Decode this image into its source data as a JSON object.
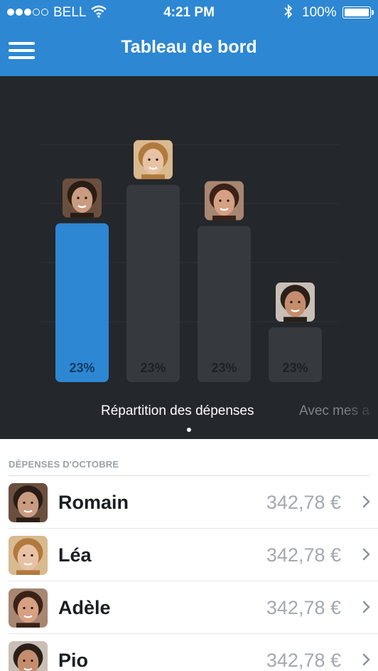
{
  "status_bar": {
    "carrier": "BELL",
    "time": "4:21 PM",
    "battery": "100%",
    "signal_dots_filled": 3,
    "signal_dots_total": 5
  },
  "nav": {
    "title": "Tableau de bord",
    "menu_icon": "hamburger-icon"
  },
  "colors": {
    "brand_blue": "#2d87d3",
    "chart_bg": "#24272b",
    "bar_inactive": "#363a3f",
    "avatar_skin_1": "#c99b80",
    "avatar_skin_2": "#e8c2a5",
    "avatar_skin_3": "#d6a083",
    "avatar_skin_4": "#c48d6e"
  },
  "chart": {
    "caption": "Répartition des dépenses",
    "next_caption": "Avec mes a",
    "active_page": 1
  },
  "chart_data": {
    "type": "bar",
    "categories": [
      "Romain",
      "Léa",
      "Adèle",
      "Pio"
    ],
    "values": [
      0.58,
      0.72,
      0.57,
      0.2
    ],
    "labels": [
      "23%",
      "23%",
      "23%",
      "23%"
    ],
    "highlighted_index": 0,
    "ylim": [
      0,
      1
    ],
    "grid": true
  },
  "section": {
    "title": "DÉPENSES D'OCTOBRE"
  },
  "people": [
    {
      "name": "Romain",
      "amount": "342,78 €"
    },
    {
      "name": "Léa",
      "amount": "342,78 €"
    },
    {
      "name": "Adèle",
      "amount": "342,78 €"
    },
    {
      "name": "Pio",
      "amount": "342,78 €"
    }
  ]
}
